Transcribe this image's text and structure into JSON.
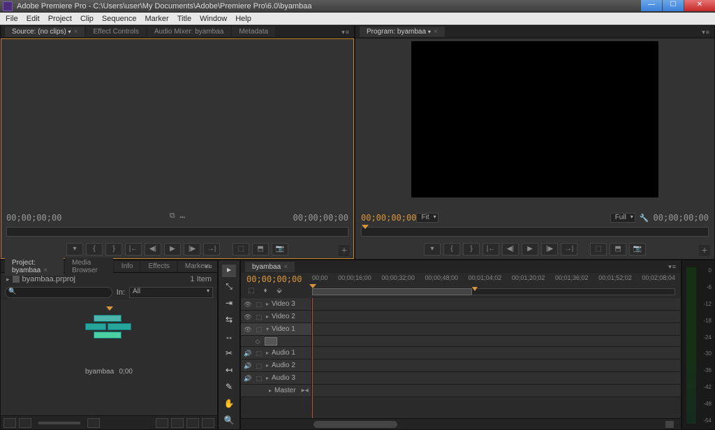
{
  "titlebar": {
    "text": "Adobe Premiere Pro - C:\\Users\\user\\My Documents\\Adobe\\Premiere Pro\\6.0\\byambaa"
  },
  "menu": [
    "File",
    "Edit",
    "Project",
    "Clip",
    "Sequence",
    "Marker",
    "Title",
    "Window",
    "Help"
  ],
  "source": {
    "tabs": [
      "Source: (no clips)",
      "Effect Controls",
      "Audio Mixer: byambaa",
      "Metadata"
    ],
    "tc_left": "00;00;00;00",
    "tc_right": "00;00;00;00"
  },
  "program": {
    "tab": "Program: byambaa",
    "fit": "Fit",
    "full": "Full",
    "tc_left": "00;00;00;00",
    "tc_right": "00;00;00;00"
  },
  "project": {
    "tabs": [
      "Project: byambaa",
      "Media Browser",
      "Info",
      "Effects",
      "Markers"
    ],
    "filename": "byambaa.prproj",
    "item_count": "1 Item",
    "in_label": "In:",
    "in_value": "All",
    "thumb_name": "byambaa",
    "thumb_dur": "0;00"
  },
  "timeline": {
    "tab": "byambaa",
    "playhead_tc": "00;00;00;00",
    "ruler": [
      "00;00",
      "00;00;16;00",
      "00;00;32;00",
      "00;00;48;00",
      "00;01;04;02",
      "00;01;20;02",
      "00;01;36;02",
      "00;01;52;02",
      "00;02;08;04"
    ],
    "tracks": {
      "v3": "Video 3",
      "v2": "Video 2",
      "v1": "Video 1",
      "a1": "Audio 1",
      "a2": "Audio 2",
      "a3": "Audio 3",
      "master": "Master"
    }
  },
  "meter_ticks": [
    "0",
    "-6",
    "-12",
    "-18",
    "-24",
    "-30",
    "-36",
    "-42",
    "-48",
    "-54"
  ]
}
